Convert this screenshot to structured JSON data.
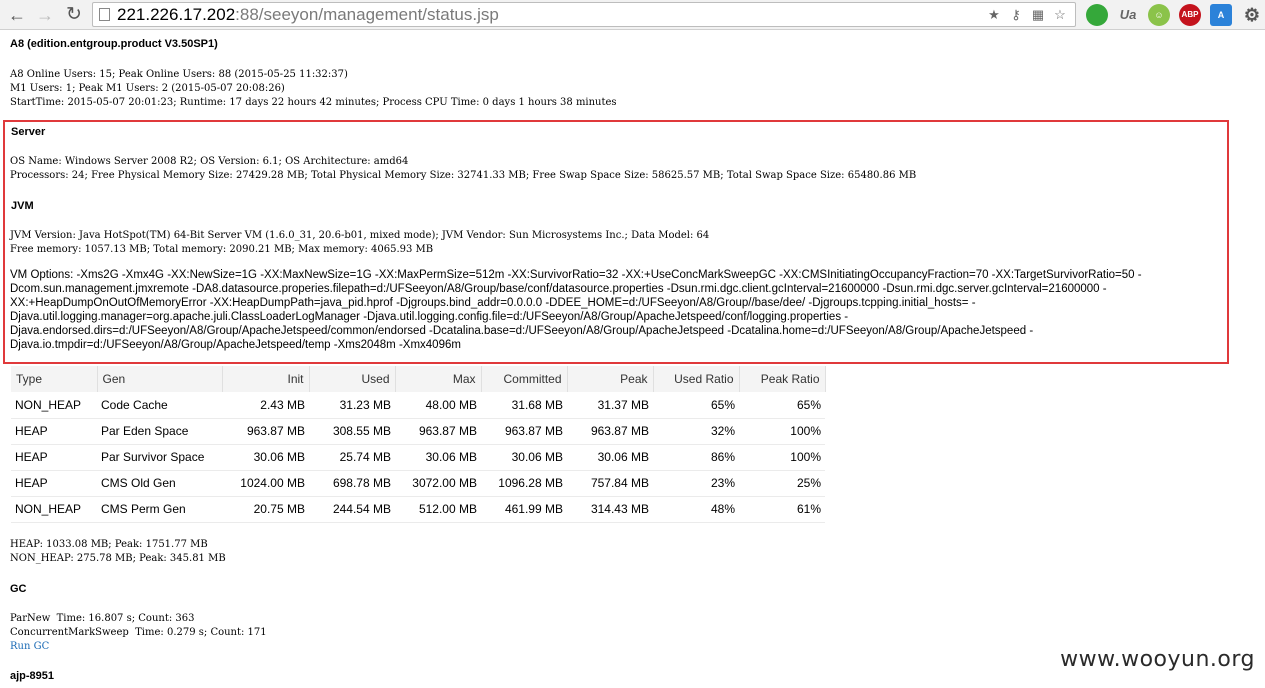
{
  "browser": {
    "url_host": "221.226.17.202",
    "url_rest": ":88/seeyon/management/status.jsp"
  },
  "page": {
    "title": "A8 (edition.entgroup.product V3.50SP1)",
    "online_line": "A8 Online Users: 15; Peak Online Users: 88 (2015-05-25 11:32:37)",
    "m1_line": "M1 Users: 1; Peak M1 Users: 2 (2015-05-07 20:08:26)",
    "start_line": "StartTime: 2015-05-07 20:01:23; Runtime: 17 days 22 hours 42 minutes; Process CPU Time: 0 days 1 hours 38 minutes"
  },
  "server": {
    "heading": "Server",
    "os_line": "OS Name: Windows Server 2008 R2; OS Version: 6.1; OS Architecture: amd64",
    "proc_line": "Processors: 24; Free Physical Memory Size: 27429.28 MB; Total Physical Memory Size: 32741.33 MB; Free Swap Space Size: 58625.57 MB; Total Swap Space Size: 65480.86 MB"
  },
  "jvm": {
    "heading": "JVM",
    "version_line": "JVM Version: Java HotSpot(TM) 64-Bit Server VM (1.6.0_31, 20.6-b01, mixed mode); JVM Vendor: Sun Microsystems Inc.; Data Model: 64",
    "memory_line": "Free memory: 1057.13 MB; Total memory: 2090.21 MB; Max memory: 4065.93 MB",
    "vm_options": "VM Options: -Xms2G -Xmx4G -XX:NewSize=1G -XX:MaxNewSize=1G -XX:MaxPermSize=512m -XX:SurvivorRatio=32 -XX:+UseConcMarkSweepGC -XX:CMSInitiatingOccupancyFraction=70 -XX:TargetSurvivorRatio=50 -Dcom.sun.management.jmxremote -DA8.datasource.properies.filepath=d:/UFSeeyon/A8/Group/base/conf/datasource.properties -Dsun.rmi.dgc.client.gcInterval=21600000 -Dsun.rmi.dgc.server.gcInterval=21600000 -XX:+HeapDumpOnOutOfMemoryError -XX:HeapDumpPath=java_pid.hprof -Djgroups.bind_addr=0.0.0.0 -DDEE_HOME=d:/UFSeeyon/A8/Group//base/dee/ -Djgroups.tcpping.initial_hosts= -Djava.util.logging.manager=org.apache.juli.ClassLoaderLogManager -Djava.util.logging.config.file=d:/UFSeeyon/A8/Group/ApacheJetspeed/conf/logging.properties -Djava.endorsed.dirs=d:/UFSeeyon/A8/Group/ApacheJetspeed/common/endorsed -Dcatalina.base=d:/UFSeeyon/A8/Group/ApacheJetspeed -Dcatalina.home=d:/UFSeeyon/A8/Group/ApacheJetspeed -Djava.io.tmpdir=d:/UFSeeyon/A8/Group/ApacheJetspeed/temp -Xms2048m -Xmx4096m"
  },
  "memory_table": {
    "headers": [
      "Type",
      "Gen",
      "Init",
      "Used",
      "Max",
      "Committed",
      "Peak",
      "Used Ratio",
      "Peak Ratio"
    ],
    "rows": [
      [
        "NON_HEAP",
        "Code Cache",
        "2.43 MB",
        "31.23 MB",
        "48.00 MB",
        "31.68 MB",
        "31.37 MB",
        "65%",
        "65%"
      ],
      [
        "HEAP",
        "Par Eden Space",
        "963.87 MB",
        "308.55 MB",
        "963.87 MB",
        "963.87 MB",
        "963.87 MB",
        "32%",
        "100%"
      ],
      [
        "HEAP",
        "Par Survivor Space",
        "30.06 MB",
        "25.74 MB",
        "30.06 MB",
        "30.06 MB",
        "30.06 MB",
        "86%",
        "100%"
      ],
      [
        "HEAP",
        "CMS Old Gen",
        "1024.00 MB",
        "698.78 MB",
        "3072.00 MB",
        "1096.28 MB",
        "757.84 MB",
        "23%",
        "25%"
      ],
      [
        "NON_HEAP",
        "CMS Perm Gen",
        "20.75 MB",
        "244.54 MB",
        "512.00 MB",
        "461.99 MB",
        "314.43 MB",
        "48%",
        "61%"
      ]
    ]
  },
  "summary": {
    "heap_line": "HEAP: 1033.08 MB; Peak: 1751.77 MB",
    "nonheap_line": "NON_HEAP: 275.78 MB; Peak: 345.81 MB"
  },
  "gc": {
    "heading": "GC",
    "parnew_line": "ParNew  Time: 16.807 s; Count: 363",
    "cms_line": "ConcurrentMarkSweep  Time: 0.279 s; Count: 171",
    "run_gc_label": "Run GC"
  },
  "ajp_heading": "ajp-8951",
  "watermark": "www.wooyun.org"
}
